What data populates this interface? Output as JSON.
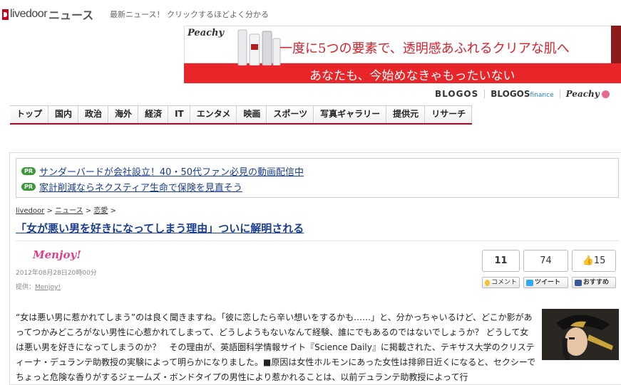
{
  "header": {
    "logo_text": "livedoor",
    "logo_section": "ニュース",
    "tagline": "最新ニュース！ クリックするほどよく分かる"
  },
  "banner": {
    "brand": "Peachy",
    "headline": "一度に5つの要素で、透明感あふれるクリアな肌へ",
    "subline": "あなたも、今始めなきゃもったいない"
  },
  "partners": {
    "blogos": "BLOGOS",
    "blogos_finance": "BLOGOS",
    "blogos_finance_suffix": "finance",
    "peachy": "Peachy"
  },
  "nav": [
    "トップ",
    "国内",
    "政治",
    "海外",
    "経済",
    "IT",
    "エンタメ",
    "映画",
    "スポーツ",
    "写真ギャラリー",
    "提供元",
    "リサーチ"
  ],
  "pr": [
    {
      "badge": "PR",
      "text": "サンダーバードが会社設立！40・50代ファン必見の動画配信中"
    },
    {
      "badge": "PR",
      "text": "家計削減ならネクスティア生命で保険を見直そう"
    }
  ],
  "breadcrumb": {
    "items": [
      "livedoor",
      "ニュース",
      "恋愛"
    ],
    "sep": " > "
  },
  "article": {
    "title": "「女が悪い男を好きになってしまう理由」ついに解明される",
    "source_logo": "Menjoy!",
    "date": "2012年08月28日20時00分",
    "provider_label": "提供：",
    "provider": "Menjoy!",
    "body": "“女は悪い男に惹かれてしまう”のは良く聞きますね。「彼に恋したら辛い想いをするかも……」と、分かっちゃいるけど、どこか影があってつかみどころがない男性に心惹かれてしまって、どうしようもないなんて経験、誰にでもあるのではないでしょうか？ どうして女は悪い男を好きになってしまうのか？　その理由が、英語圏科学情報サイト『Science Daily』に掲載された、テキサス大学のクリスティーナ・デュランテ助教授の実験によって明らかになりました。■原因は女性ホルモンにあった女性は排卵日近くになると、セクシーでちょっと危険な香りがするジェームズ・ボンドタイプの男性により惹かれることは、以前デュランテ助教授によって行"
  },
  "social": {
    "comment_count": "11",
    "tweet_count": "74",
    "like_count": "15",
    "comment_label": "コメント",
    "tweet_label": "ツイート",
    "bookmark_label": "おすすめ"
  },
  "colors": {
    "accent": "#c8001e",
    "link": "#1a3d8f",
    "banner_red": "#e8262a",
    "pr_green": "#3a9a3a"
  }
}
